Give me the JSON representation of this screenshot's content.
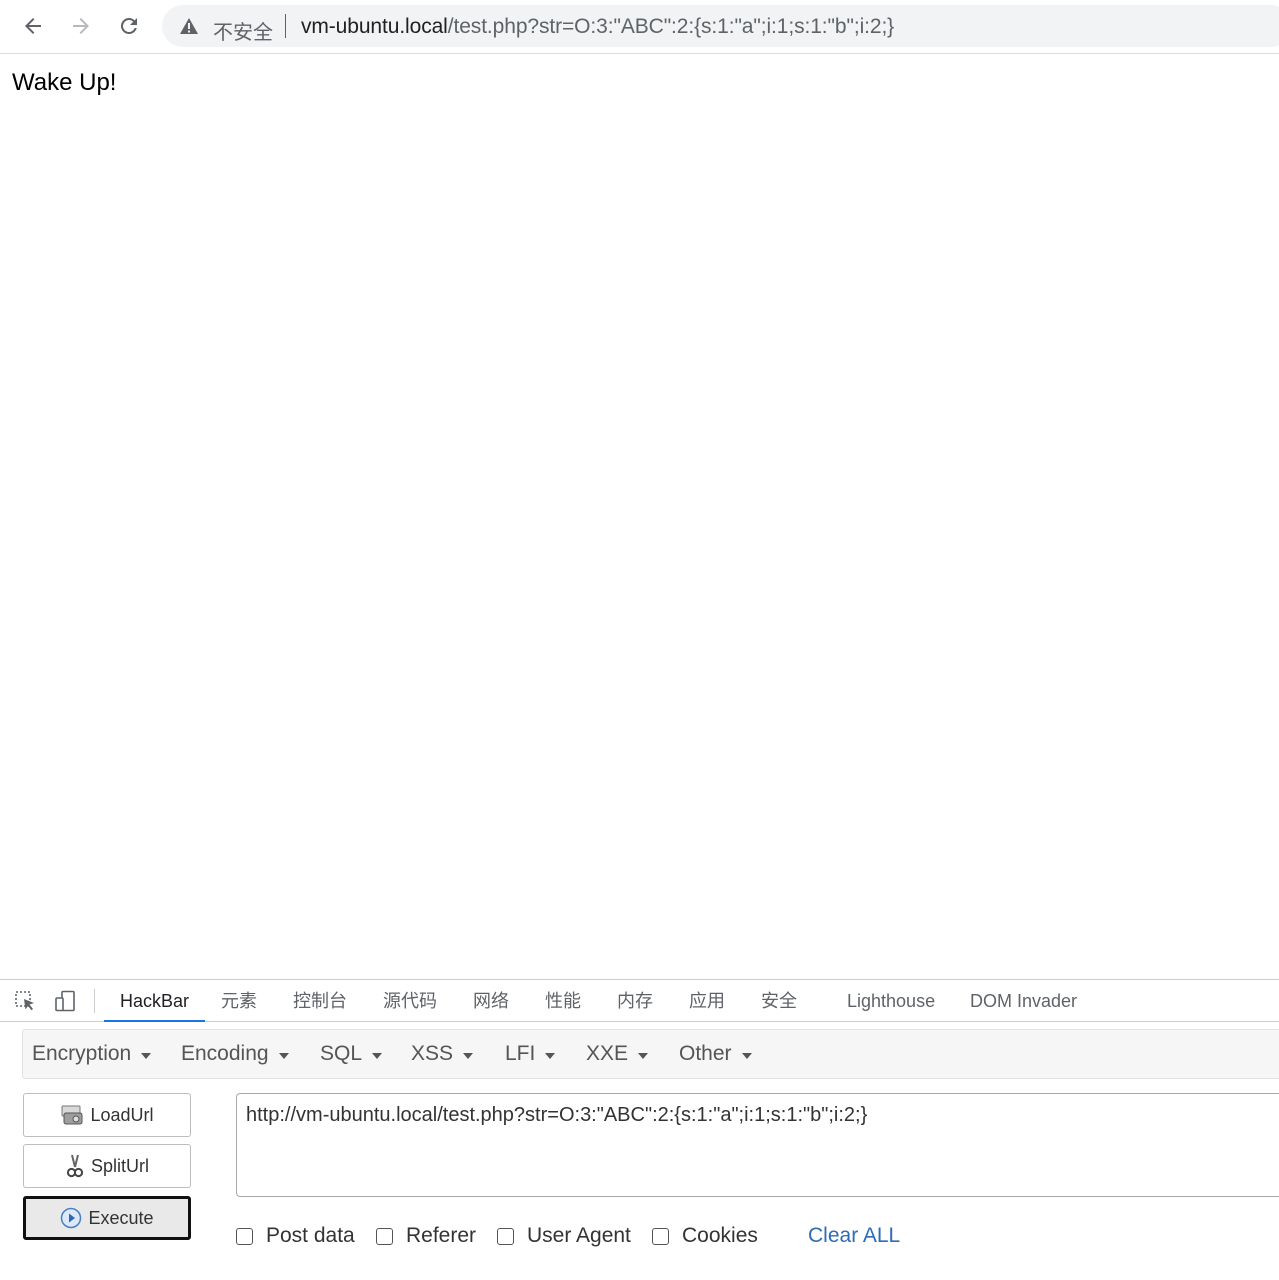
{
  "browser": {
    "security_label": "不安全",
    "url_host": "vm-ubuntu.local",
    "url_path": "/test.php?str=O:3:\"ABC\":2:{s:1:\"a\";i:1;s:1:\"b\";i:2;}"
  },
  "page": {
    "text": "Wake Up!"
  },
  "devtools": {
    "tabs": [
      {
        "label": "HackBar",
        "active": true
      },
      {
        "label": "元素"
      },
      {
        "label": "控制台"
      },
      {
        "label": "源代码"
      },
      {
        "label": "网络"
      },
      {
        "label": "性能"
      },
      {
        "label": "内存"
      },
      {
        "label": "应用"
      },
      {
        "label": "安全"
      },
      {
        "label": "Lighthouse"
      },
      {
        "label": "DOM Invader"
      }
    ],
    "accent_color": "#1a73e8"
  },
  "hackbar": {
    "menu": [
      "Encryption",
      "Encoding",
      "SQL",
      "XSS",
      "LFI",
      "XXE",
      "Other"
    ],
    "buttons": {
      "load": "LoadUrl",
      "split": "SplitUrl",
      "execute": "Execute"
    },
    "url_value": "http://vm-ubuntu.local/test.php?str=O:3:\"ABC\":2:{s:1:\"a\";i:1;s:1:\"b\";i:2;}",
    "options": [
      "Post data",
      "Referer",
      "User Agent",
      "Cookies"
    ],
    "clear_label": "Clear ALL",
    "link_color": "#2c6cb8"
  }
}
